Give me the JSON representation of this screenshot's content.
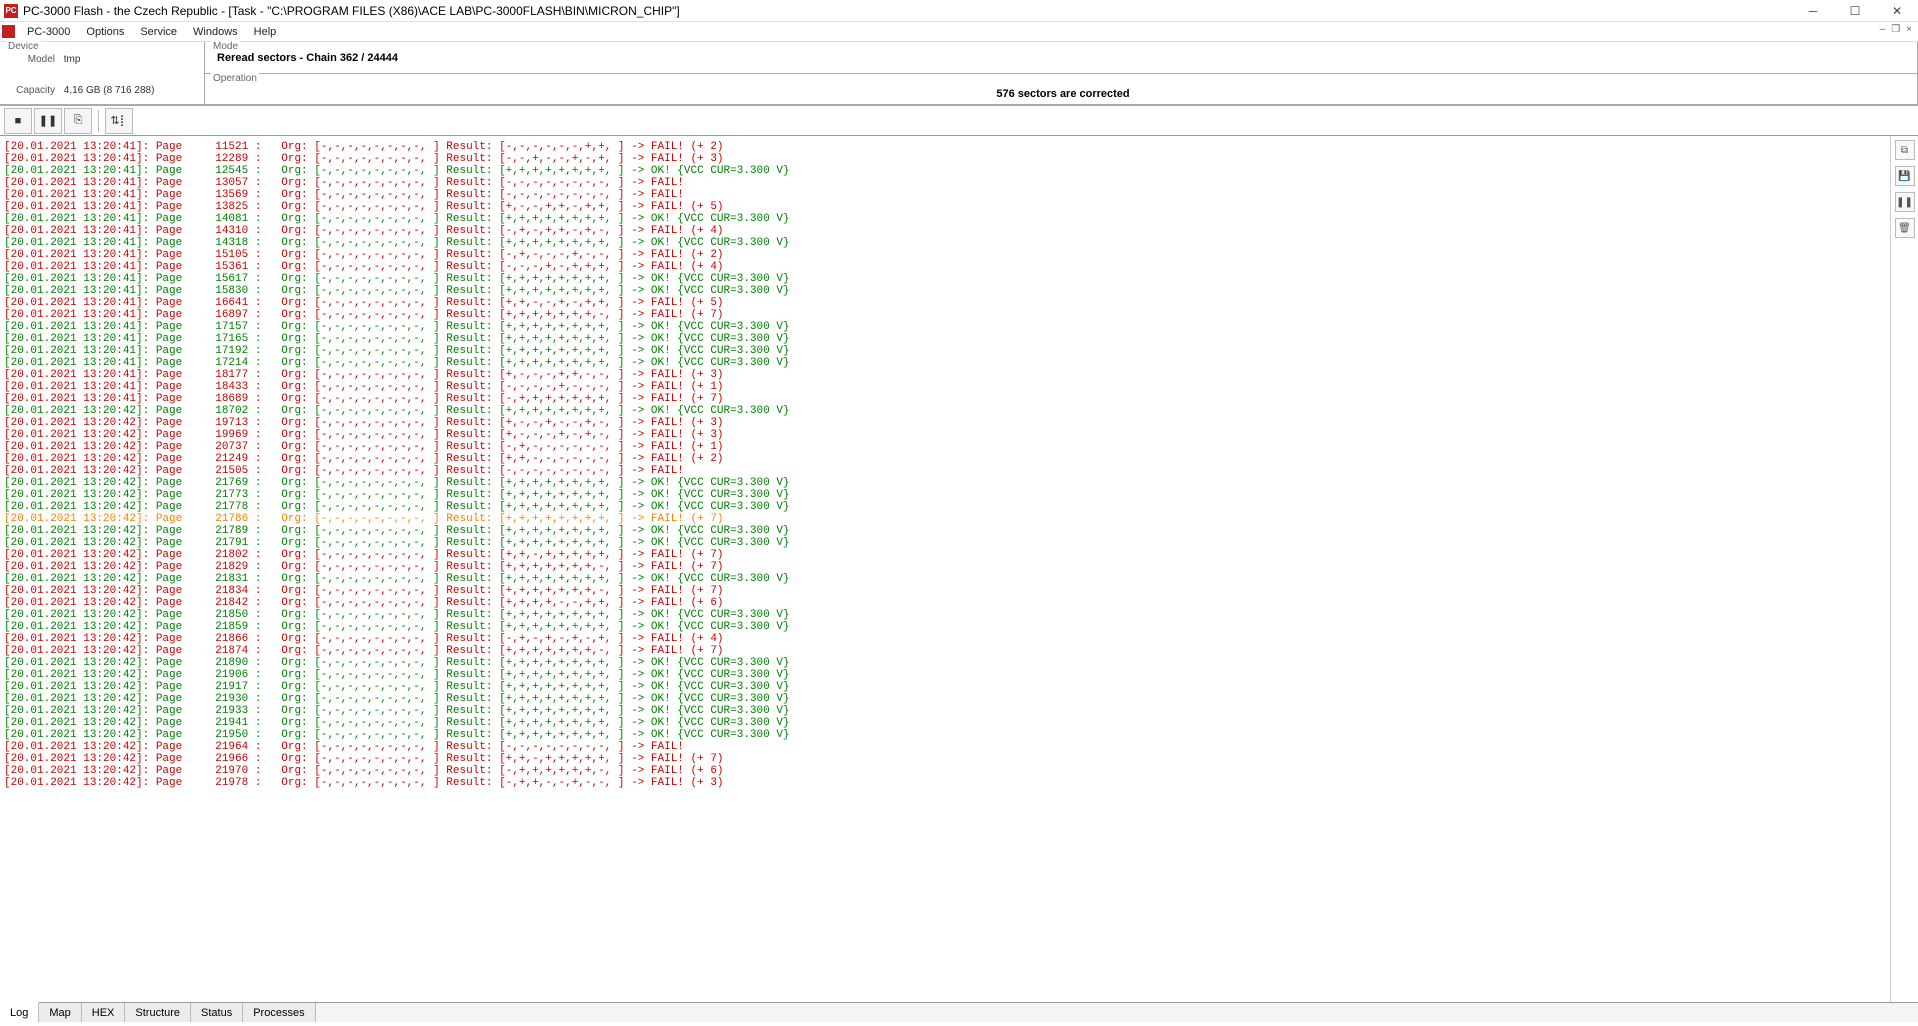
{
  "title": "PC-3000 Flash - the Czech Republic - [Task - \"C:\\PROGRAM FILES (X86)\\ACE LAB\\PC-3000FLASH\\BIN\\MICRON_CHIP\"]",
  "menu": [
    "PC-3000",
    "Options",
    "Service",
    "Windows",
    "Help"
  ],
  "device": {
    "group": "Device",
    "model_label": "Model",
    "model_value": "tmp",
    "capacity_label": "Capacity",
    "capacity_value": "4,16 GB (8 716 288)"
  },
  "mode": {
    "group": "Mode",
    "text": "Reread sectors - Chain 362 / 24444"
  },
  "operation": {
    "group": "Operation",
    "text": "576 sectors are corrected"
  },
  "tabs": [
    "Log",
    "Map",
    "HEX",
    "Structure",
    "Status",
    "Processes"
  ],
  "active_tab": "Log",
  "log": [
    {
      "c": "red",
      "t": "[20.01.2021 13:20:41]: Page     11521 :   Org: [-,-,-,-,-,-,-,-, ] Result: [-,-,-,-,-,-,+,+, ] -> FAIL! (+ 2)"
    },
    {
      "c": "red",
      "t": "[20.01.2021 13:20:41]: Page     12289 :   Org: [-,-,-,-,-,-,-,-, ] Result: [-,-,+,-,-,+,-,+, ] -> FAIL! (+ 3)"
    },
    {
      "c": "green",
      "t": "[20.01.2021 13:20:41]: Page     12545 :   Org: [-,-,-,-,-,-,-,-, ] Result: [+,+,+,+,+,+,+,+, ] -> OK! {VCC CUR=3.300 V}"
    },
    {
      "c": "red",
      "t": "[20.01.2021 13:20:41]: Page     13057 :   Org: [-,-,-,-,-,-,-,-, ] Result: [-,-,-,-,-,-,-,-, ] -> FAIL!"
    },
    {
      "c": "red",
      "t": "[20.01.2021 13:20:41]: Page     13569 :   Org: [-,-,-,-,-,-,-,-, ] Result: [-,-,-,-,-,-,-,-, ] -> FAIL!"
    },
    {
      "c": "red",
      "t": "[20.01.2021 13:20:41]: Page     13825 :   Org: [-,-,-,-,-,-,-,-, ] Result: [+,-,-,+,+,-,+,+, ] -> FAIL! (+ 5)"
    },
    {
      "c": "green",
      "t": "[20.01.2021 13:20:41]: Page     14081 :   Org: [-,-,-,-,-,-,-,-, ] Result: [+,+,+,+,+,+,+,+, ] -> OK! {VCC CUR=3.300 V}"
    },
    {
      "c": "red",
      "t": "[20.01.2021 13:20:41]: Page     14310 :   Org: [-,-,-,-,-,-,-,-, ] Result: [-,+,-,+,+,-,+,-, ] -> FAIL! (+ 4)"
    },
    {
      "c": "green",
      "t": "[20.01.2021 13:20:41]: Page     14318 :   Org: [-,-,-,-,-,-,-,-, ] Result: [+,+,+,+,+,+,+,+, ] -> OK! {VCC CUR=3.300 V}"
    },
    {
      "c": "red",
      "t": "[20.01.2021 13:20:41]: Page     15105 :   Org: [-,-,-,-,-,-,-,-, ] Result: [-,+,-,-,-,+,-,-, ] -> FAIL! (+ 2)"
    },
    {
      "c": "red",
      "t": "[20.01.2021 13:20:41]: Page     15361 :   Org: [-,-,-,-,-,-,-,-, ] Result: [-,-,-,+,-,+,+,+, ] -> FAIL! (+ 4)"
    },
    {
      "c": "green",
      "t": "[20.01.2021 13:20:41]: Page     15617 :   Org: [-,-,-,-,-,-,-,-, ] Result: [+,+,+,+,+,+,+,+, ] -> OK! {VCC CUR=3.300 V}"
    },
    {
      "c": "green",
      "t": "[20.01.2021 13:20:41]: Page     15830 :   Org: [-,-,-,-,-,-,-,-, ] Result: [+,+,+,+,+,+,+,+, ] -> OK! {VCC CUR=3.300 V}"
    },
    {
      "c": "red",
      "t": "[20.01.2021 13:20:41]: Page     16641 :   Org: [-,-,-,-,-,-,-,-, ] Result: [+,+,-,-,+,-,+,+, ] -> FAIL! (+ 5)"
    },
    {
      "c": "red",
      "t": "[20.01.2021 13:20:41]: Page     16897 :   Org: [-,-,-,-,-,-,-,-, ] Result: [+,+,+,+,+,+,+,-, ] -> FAIL! (+ 7)"
    },
    {
      "c": "green",
      "t": "[20.01.2021 13:20:41]: Page     17157 :   Org: [-,-,-,-,-,-,-,-, ] Result: [+,+,+,+,+,+,+,+, ] -> OK! {VCC CUR=3.300 V}"
    },
    {
      "c": "green",
      "t": "[20.01.2021 13:20:41]: Page     17165 :   Org: [-,-,-,-,-,-,-,-, ] Result: [+,+,+,+,+,+,+,+, ] -> OK! {VCC CUR=3.300 V}"
    },
    {
      "c": "green",
      "t": "[20.01.2021 13:20:41]: Page     17192 :   Org: [-,-,-,-,-,-,-,-, ] Result: [+,+,+,+,+,+,+,+, ] -> OK! {VCC CUR=3.300 V}"
    },
    {
      "c": "green",
      "t": "[20.01.2021 13:20:41]: Page     17214 :   Org: [-,-,-,-,-,-,-,-, ] Result: [+,+,+,+,+,+,+,+, ] -> OK! {VCC CUR=3.300 V}"
    },
    {
      "c": "red",
      "t": "[20.01.2021 13:20:41]: Page     18177 :   Org: [-,-,-,-,-,-,-,-, ] Result: [+,-,-,-,+,+,-,-, ] -> FAIL! (+ 3)"
    },
    {
      "c": "red",
      "t": "[20.01.2021 13:20:41]: Page     18433 :   Org: [-,-,-,-,-,-,-,-, ] Result: [-,-,-,-,+,-,-,-, ] -> FAIL! (+ 1)"
    },
    {
      "c": "red",
      "t": "[20.01.2021 13:20:41]: Page     18689 :   Org: [-,-,-,-,-,-,-,-, ] Result: [-,+,+,+,+,+,+,+, ] -> FAIL! (+ 7)"
    },
    {
      "c": "green",
      "t": "[20.01.2021 13:20:42]: Page     18702 :   Org: [-,-,-,-,-,-,-,-, ] Result: [+,+,+,+,+,+,+,+, ] -> OK! {VCC CUR=3.300 V}"
    },
    {
      "c": "red",
      "t": "[20.01.2021 13:20:42]: Page     19713 :   Org: [-,-,-,-,-,-,-,-, ] Result: [+,-,-,+,-,-,+,-, ] -> FAIL! (+ 3)"
    },
    {
      "c": "red",
      "t": "[20.01.2021 13:20:42]: Page     19969 :   Org: [-,-,-,-,-,-,-,-, ] Result: [+,-,-,-,+,-,+,-, ] -> FAIL! (+ 3)"
    },
    {
      "c": "red",
      "t": "[20.01.2021 13:20:42]: Page     20737 :   Org: [-,-,-,-,-,-,-,-, ] Result: [-,+,-,-,-,-,-,-, ] -> FAIL! (+ 1)"
    },
    {
      "c": "red",
      "t": "[20.01.2021 13:20:42]: Page     21249 :   Org: [-,-,-,-,-,-,-,-, ] Result: [+,+,-,-,-,-,-,-, ] -> FAIL! (+ 2)"
    },
    {
      "c": "red",
      "t": "[20.01.2021 13:20:42]: Page     21505 :   Org: [-,-,-,-,-,-,-,-, ] Result: [-,-,-,-,-,-,-,-, ] -> FAIL!"
    },
    {
      "c": "green",
      "t": "[20.01.2021 13:20:42]: Page     21769 :   Org: [-,-,-,-,-,-,-,-, ] Result: [+,+,+,+,+,+,+,+, ] -> OK! {VCC CUR=3.300 V}"
    },
    {
      "c": "green",
      "t": "[20.01.2021 13:20:42]: Page     21773 :   Org: [-,-,-,-,-,-,-,-, ] Result: [+,+,+,+,+,+,+,+, ] -> OK! {VCC CUR=3.300 V}"
    },
    {
      "c": "green",
      "t": "[20.01.2021 13:20:42]: Page     21778 :   Org: [-,-,-,-,-,-,-,-, ] Result: [+,+,+,+,+,+,+,+, ] -> OK! {VCC CUR=3.300 V}"
    },
    {
      "c": "orange",
      "t": "[20.01.2021 13:20:42]: Page     21786 :   Org: [-,-,-,-,-,-,-,-, ] Result: [+,+,+,+,+,+,+,+, ] -> FAIL! (+ 7)"
    },
    {
      "c": "green",
      "t": "[20.01.2021 13:20:42]: Page     21789 :   Org: [-,-,-,-,-,-,-,-, ] Result: [+,+,+,+,+,+,+,+, ] -> OK! {VCC CUR=3.300 V}"
    },
    {
      "c": "green",
      "t": "[20.01.2021 13:20:42]: Page     21791 :   Org: [-,-,-,-,-,-,-,-, ] Result: [+,+,+,+,+,+,+,+, ] -> OK! {VCC CUR=3.300 V}"
    },
    {
      "c": "red",
      "t": "[20.01.2021 13:20:42]: Page     21802 :   Org: [-,-,-,-,-,-,-,-, ] Result: [+,+,-,+,+,+,+,+, ] -> FAIL! (+ 7)"
    },
    {
      "c": "red",
      "t": "[20.01.2021 13:20:42]: Page     21829 :   Org: [-,-,-,-,-,-,-,-, ] Result: [+,+,+,+,+,+,+,-, ] -> FAIL! (+ 7)"
    },
    {
      "c": "green",
      "t": "[20.01.2021 13:20:42]: Page     21831 :   Org: [-,-,-,-,-,-,-,-, ] Result: [+,+,+,+,+,+,+,+, ] -> OK! {VCC CUR=3.300 V}"
    },
    {
      "c": "red",
      "t": "[20.01.2021 13:20:42]: Page     21834 :   Org: [-,-,-,-,-,-,-,-, ] Result: [+,+,+,+,+,+,+,-, ] -> FAIL! (+ 7)"
    },
    {
      "c": "red",
      "t": "[20.01.2021 13:20:42]: Page     21842 :   Org: [-,-,-,-,-,-,-,-, ] Result: [+,+,+,+,-,-,+,+, ] -> FAIL! (+ 6)"
    },
    {
      "c": "green",
      "t": "[20.01.2021 13:20:42]: Page     21850 :   Org: [-,-,-,-,-,-,-,-, ] Result: [+,+,+,+,+,+,+,+, ] -> OK! {VCC CUR=3.300 V}"
    },
    {
      "c": "green",
      "t": "[20.01.2021 13:20:42]: Page     21859 :   Org: [-,-,-,-,-,-,-,-, ] Result: [+,+,+,+,+,+,+,+, ] -> OK! {VCC CUR=3.300 V}"
    },
    {
      "c": "red",
      "t": "[20.01.2021 13:20:42]: Page     21866 :   Org: [-,-,-,-,-,-,-,-, ] Result: [-,+,-,+,-,+,-,+, ] -> FAIL! (+ 4)"
    },
    {
      "c": "red",
      "t": "[20.01.2021 13:20:42]: Page     21874 :   Org: [-,-,-,-,-,-,-,-, ] Result: [+,+,+,+,+,+,+,-, ] -> FAIL! (+ 7)"
    },
    {
      "c": "green",
      "t": "[20.01.2021 13:20:42]: Page     21890 :   Org: [-,-,-,-,-,-,-,-, ] Result: [+,+,+,+,+,+,+,+, ] -> OK! {VCC CUR=3.300 V}"
    },
    {
      "c": "green",
      "t": "[20.01.2021 13:20:42]: Page     21906 :   Org: [-,-,-,-,-,-,-,-, ] Result: [+,+,+,+,+,+,+,+, ] -> OK! {VCC CUR=3.300 V}"
    },
    {
      "c": "green",
      "t": "[20.01.2021 13:20:42]: Page     21917 :   Org: [-,-,-,-,-,-,-,-, ] Result: [+,+,+,+,+,+,+,+, ] -> OK! {VCC CUR=3.300 V}"
    },
    {
      "c": "green",
      "t": "[20.01.2021 13:20:42]: Page     21930 :   Org: [-,-,-,-,-,-,-,-, ] Result: [+,+,+,+,+,+,+,+, ] -> OK! {VCC CUR=3.300 V}"
    },
    {
      "c": "green",
      "t": "[20.01.2021 13:20:42]: Page     21933 :   Org: [-,-,-,-,-,-,-,-, ] Result: [+,+,+,+,+,+,+,+, ] -> OK! {VCC CUR=3.300 V}"
    },
    {
      "c": "green",
      "t": "[20.01.2021 13:20:42]: Page     21941 :   Org: [-,-,-,-,-,-,-,-, ] Result: [+,+,+,+,+,+,+,+, ] -> OK! {VCC CUR=3.300 V}"
    },
    {
      "c": "green",
      "t": "[20.01.2021 13:20:42]: Page     21950 :   Org: [-,-,-,-,-,-,-,-, ] Result: [+,+,+,+,+,+,+,+, ] -> OK! {VCC CUR=3.300 V}"
    },
    {
      "c": "red",
      "t": "[20.01.2021 13:20:42]: Page     21964 :   Org: [-,-,-,-,-,-,-,-, ] Result: [-,-,-,-,-,-,-,-, ] -> FAIL!"
    },
    {
      "c": "red",
      "t": "[20.01.2021 13:20:42]: Page     21966 :   Org: [-,-,-,-,-,-,-,-, ] Result: [+,+,-,+,+,+,+,+, ] -> FAIL! (+ 7)"
    },
    {
      "c": "red",
      "t": "[20.01.2021 13:20:42]: Page     21970 :   Org: [-,-,-,-,-,-,-,-, ] Result: [-,+,+,+,+,+,+,-, ] -> FAIL! (+ 6)"
    },
    {
      "c": "red",
      "t": "[20.01.2021 13:20:42]: Page     21978 :   Org: [-,-,-,-,-,-,-,-, ] Result: [-,+,+,-,-,+,-,-, ] -> FAIL! (+ 3)"
    }
  ]
}
